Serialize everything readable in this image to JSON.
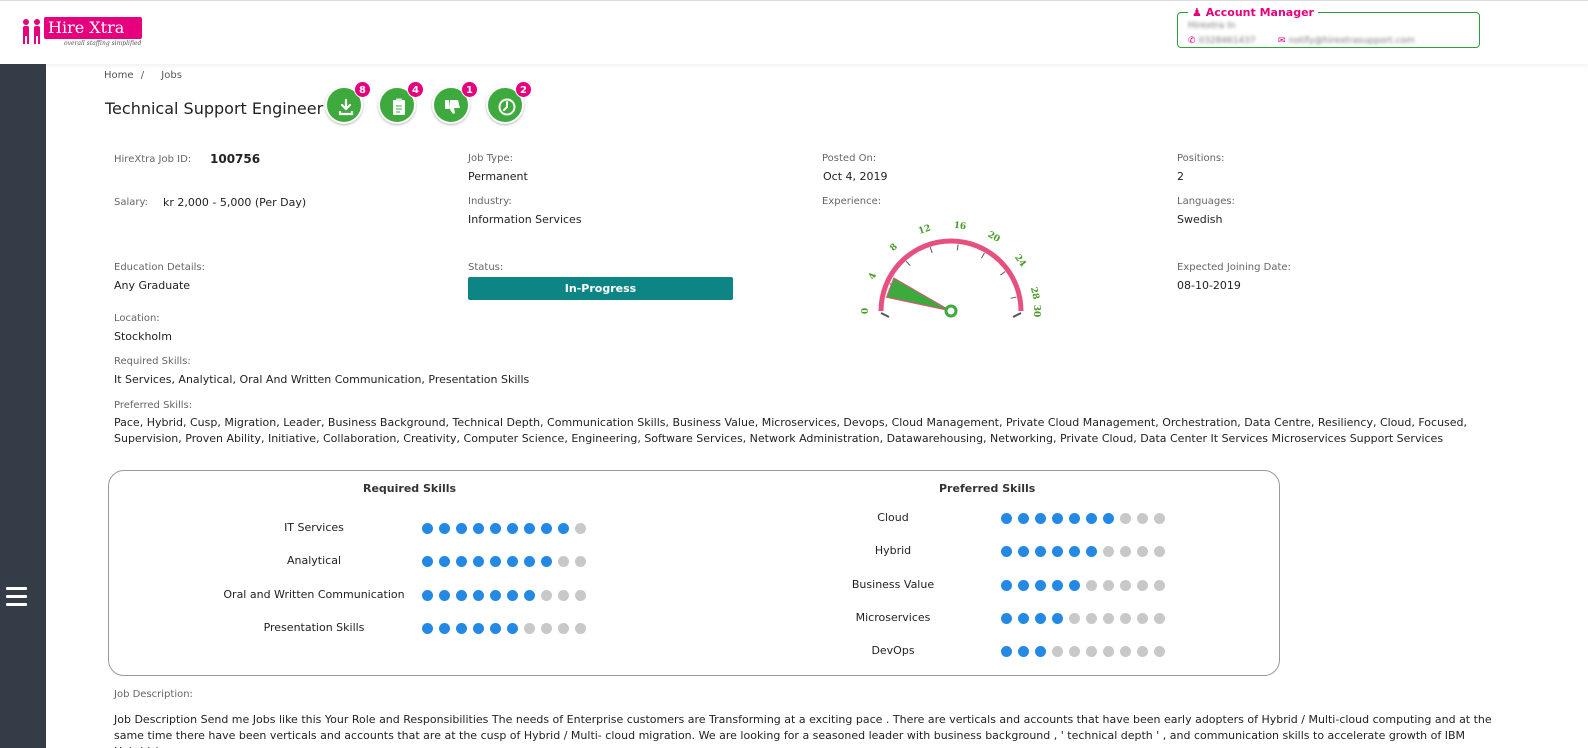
{
  "header": {
    "logo_text": "Hire Xtra",
    "logo_tagline": "overall staffing simplified",
    "account_manager": {
      "label": "Account Manager",
      "name": "Hirextra In",
      "phone": "0328461437",
      "email": "notify@hirextrasupport.com"
    }
  },
  "breadcrumb": {
    "home": "Home",
    "separator": "/",
    "current": "Jobs"
  },
  "job": {
    "title": "Technical Support Engineer",
    "actions": [
      {
        "name": "download",
        "badge": "8"
      },
      {
        "name": "clipboard",
        "badge": "4"
      },
      {
        "name": "thumbs-down",
        "badge": "1"
      },
      {
        "name": "history",
        "badge": "2"
      }
    ],
    "fields": {
      "job_id_label": "HireXtra Job ID:",
      "job_id": "100756",
      "salary_label": "Salary:",
      "salary": "kr 2,000 - 5,000 (Per Day)",
      "job_type_label": "Job Type:",
      "job_type": "Permanent",
      "posted_label": "Posted On:",
      "posted": "Oct 4, 2019",
      "positions_label": "Positions:",
      "positions": "2",
      "industry_label": "Industry:",
      "industry": "Information Services",
      "experience_label": "Experience:",
      "languages_label": "Languages:",
      "languages": "Swedish",
      "education_label": "Education Details:",
      "education": "Any Graduate",
      "status_label": "Status:",
      "status": "In-Progress",
      "joining_label": "Expected Joining Date:",
      "joining": "08-10-2019",
      "location_label": "Location:",
      "location": "Stockholm",
      "required_label": "Required Skills:",
      "required": "It Services, Analytical, Oral And Written Communication, Presentation Skills",
      "preferred_label": "Preferred Skills:",
      "preferred": "Pace, Hybrid, Cusp, Migration, Leader, Business Background, Technical Depth, Communication Skills, Business Value, Microservices, Devops, Cloud Management, Private Cloud Management, Orchestration, Data Centre, Resiliency, Cloud, Focused, Supervision, Proven Ability, Initiative, Collaboration, Creativity, Computer Science, Engineering, Software Services, Network Administration, Datawarehousing, Networking, Private Cloud, Data Center It Services Microservices Support Services"
    },
    "experience_gauge": {
      "min": 0,
      "max": 30,
      "ticks": [
        "0",
        "4",
        "8",
        "12",
        "16",
        "20",
        "24",
        "28",
        "30"
      ],
      "range_from": 2,
      "range_to": 5,
      "needle_color": "#3eaa3e",
      "arc_color": "#e64f7e"
    },
    "description_label": "Job Description:",
    "description": "Job Description Send me Jobs like this Your Role and Responsibilities The needs of Enterprise customers are Transforming at a exciting pace . There are verticals and accounts that have been early adopters of Hybrid / Multi-cloud computing and at the same time there have been verticals and accounts that are at the cusp of Hybrid / Multi- cloud migration. We are looking for a seasoned leader with business background , ' technical depth ' , and communication skills to accelerate growth of IBM Hybrid /"
  },
  "skills_card": {
    "required_title": "Required Skills",
    "preferred_title": "Preferred Skills",
    "max_level": 10,
    "required": [
      {
        "name": "IT Services",
        "level": 9
      },
      {
        "name": "Analytical",
        "level": 8
      },
      {
        "name": "Oral and Written Communication",
        "level": 7
      },
      {
        "name": "Presentation Skills",
        "level": 6
      }
    ],
    "preferred": [
      {
        "name": "Cloud",
        "level": 7
      },
      {
        "name": "Hybrid",
        "level": 6
      },
      {
        "name": "Business Value",
        "level": 5
      },
      {
        "name": "Microservices",
        "level": 4
      },
      {
        "name": "DevOps",
        "level": 3
      }
    ],
    "on_color": "#2389e3",
    "off_color": "#c8c8c8"
  }
}
